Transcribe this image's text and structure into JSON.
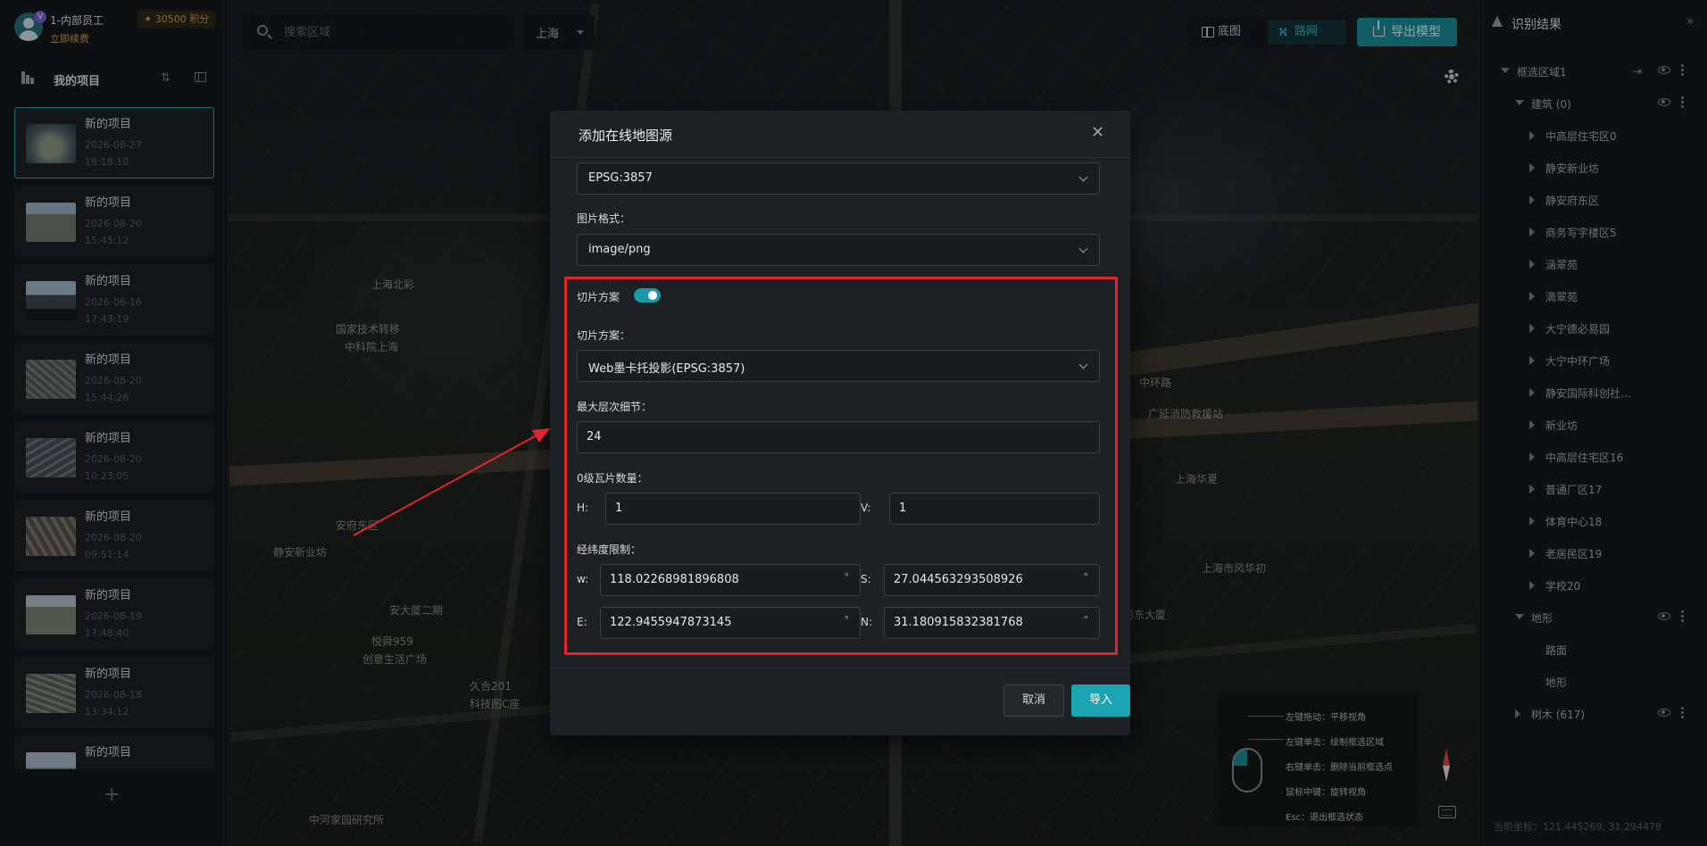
{
  "user": {
    "name": "1-内部员工",
    "badge": "V",
    "renew_label": "立即续费",
    "points": "✦ 30500 积分"
  },
  "projects": {
    "title": "我的项目",
    "add_symbol": "+",
    "items": [
      {
        "name": "新的项目",
        "date": "2026-08-27",
        "time": "19:18:10"
      },
      {
        "name": "新的项目",
        "date": "2026-08-20",
        "time": "15:45:12"
      },
      {
        "name": "新的项目",
        "date": "2026-06-16",
        "time": "17:43:19"
      },
      {
        "name": "新的项目",
        "date": "2026-08-20",
        "time": "15:44:26"
      },
      {
        "name": "新的项目",
        "date": "2026-08-20",
        "time": "10:23:05"
      },
      {
        "name": "新的项目",
        "date": "2026-08-20",
        "time": "09:51:14"
      },
      {
        "name": "新的项目",
        "date": "2026-08-19",
        "time": "17:48:40"
      },
      {
        "name": "新的项目",
        "date": "2026-08-18",
        "time": "13:34:12"
      },
      {
        "name": "新的项目",
        "date": "",
        "time": ""
      }
    ]
  },
  "search": {
    "placeholder": "搜索区域",
    "city": "上海"
  },
  "toolbar": {
    "basemap_label": "底图",
    "roadnet_label": "路网",
    "export_label": "导出模型",
    "road_glyph": "⛕"
  },
  "map_labels": [
    "静安新业坊",
    "中环路",
    "上海华夏",
    "上海市风华初",
    "悦舜959",
    "广延消防救援站",
    "国家技术转移",
    "中科院上海",
    "上海北彩",
    "安大厦二期",
    "安府东区",
    "科技图C座",
    "中河家园研究所",
    "华局东大厦",
    "创意生活广场",
    "久合201"
  ],
  "help": {
    "items": [
      "左键拖动：平移视角",
      "左键单击：绘制框选区域",
      "右键单击：删除当前框选点",
      "鼠标中键：旋转视角",
      "Esc：退出框选状态"
    ]
  },
  "results": {
    "title": "识别结果",
    "collapse_glyph": "»",
    "exit_glyph": "⇥",
    "tree": [
      {
        "label": "框选区域1",
        "level": 0,
        "caret": "down",
        "eye": true,
        "more": true,
        "exit": true
      },
      {
        "label": "建筑 (0)",
        "level": 1,
        "caret": "down",
        "eye": true,
        "more": true
      },
      {
        "label": "中高层住宅区0",
        "level": 2,
        "caret": "right"
      },
      {
        "label": "静安新业坊",
        "level": 2,
        "caret": "right"
      },
      {
        "label": "静安府东区",
        "level": 2,
        "caret": "right"
      },
      {
        "label": "商务写字楼区5",
        "level": 2,
        "caret": "right"
      },
      {
        "label": "涵翠苑",
        "level": 2,
        "caret": "right"
      },
      {
        "label": "滴翠苑",
        "level": 2,
        "caret": "right"
      },
      {
        "label": "大宁德必易园",
        "level": 2,
        "caret": "right"
      },
      {
        "label": "大宁中环广场",
        "level": 2,
        "caret": "right"
      },
      {
        "label": "静安国际科创社…",
        "level": 2,
        "caret": "right"
      },
      {
        "label": "新业坊",
        "level": 2,
        "caret": "right"
      },
      {
        "label": "中高层住宅区16",
        "level": 2,
        "caret": "right"
      },
      {
        "label": "普通厂区17",
        "level": 2,
        "caret": "right"
      },
      {
        "label": "体育中心18",
        "level": 2,
        "caret": "right"
      },
      {
        "label": "老居民区19",
        "level": 2,
        "caret": "right"
      },
      {
        "label": "学校20",
        "level": 2,
        "caret": "right"
      },
      {
        "label": "地形",
        "level": 1,
        "caret": "down",
        "eye": true,
        "more": true
      },
      {
        "label": "路面",
        "level": 2,
        "caret": "none"
      },
      {
        "label": "地形",
        "level": 2,
        "caret": "none"
      },
      {
        "label": "树木 (617)",
        "level": 1,
        "caret": "right",
        "eye": true,
        "more": true
      }
    ],
    "coords": "当前坐标：121.445269, 31.294478"
  },
  "modal": {
    "title": "添加在线地图源",
    "close_glyph": "✕",
    "crs_value": "EPSG:3857",
    "image_format_label": "图片格式：",
    "image_format_value": "image/png",
    "tiling_toggle_label": "切片方案",
    "tiling_toggle_on": true,
    "tiling_label": "切片方案：",
    "tiling_value": "Web墨卡托投影(EPSG:3857)",
    "max_lod_label": "最大层次细节：",
    "max_lod_value": "24",
    "tiles_label": "0级瓦片数量：",
    "h_label": "H:",
    "h_value": "1",
    "v_label": "V:",
    "v_value": "1",
    "bounds_label": "经纬度限制：",
    "w_label": "w:",
    "w_value": "118.02268981896808",
    "s_label": "S:",
    "s_value": "27.044563293508926",
    "e_label": "E:",
    "e_value": "122.9455947873145",
    "n_label": "N:",
    "n_value": "31.180915832381768",
    "degree_unit": "°",
    "cancel_label": "取消",
    "import_label": "导入"
  },
  "colors": {
    "accent": "#1aa4b2",
    "highlight_box": "#e0262a",
    "points": "#d6a24a"
  }
}
